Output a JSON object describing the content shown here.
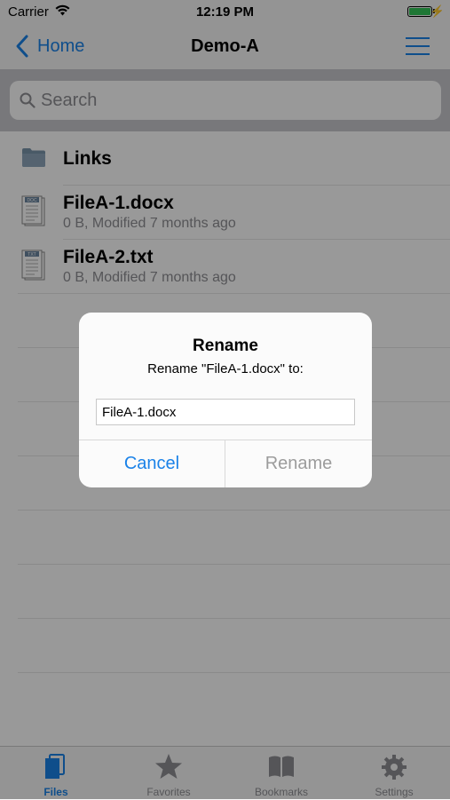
{
  "status_bar": {
    "carrier": "Carrier",
    "time": "12:19 PM"
  },
  "nav": {
    "back_label": "Home",
    "title": "Demo-A"
  },
  "search": {
    "placeholder": "Search"
  },
  "files": [
    {
      "name": "Links",
      "type": "folder"
    },
    {
      "name": "FileA-1.docx",
      "meta": "0 B, Modified 7 months ago",
      "badge": "DOC"
    },
    {
      "name": "FileA-2.txt",
      "meta": "0 B, Modified 7 months ago",
      "badge": "TXT"
    }
  ],
  "tabs": [
    {
      "label": "Files",
      "icon": "files-icon",
      "active": true
    },
    {
      "label": "Favorites",
      "icon": "star-icon"
    },
    {
      "label": "Bookmarks",
      "icon": "book-icon"
    },
    {
      "label": "Settings",
      "icon": "gear-icon"
    }
  ],
  "dialog": {
    "title": "Rename",
    "message": "Rename \"FileA-1.docx\" to:",
    "value": "FileA-1.docx",
    "cancel": "Cancel",
    "confirm": "Rename"
  },
  "colors": {
    "accent": "#1a82e8",
    "battery": "#35c759"
  }
}
